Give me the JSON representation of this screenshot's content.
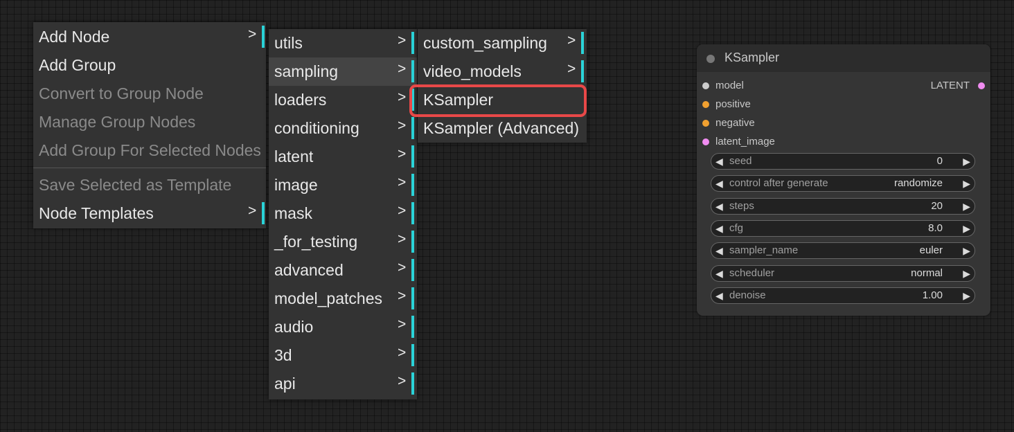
{
  "context_menu": {
    "items": [
      {
        "label": "Add Node",
        "has_submenu": true,
        "disabled": false
      },
      {
        "label": "Add Group",
        "has_submenu": false,
        "disabled": false
      },
      {
        "label": "Convert to Group Node",
        "has_submenu": false,
        "disabled": true
      },
      {
        "label": "Manage Group Nodes",
        "has_submenu": false,
        "disabled": true
      },
      {
        "label": "Add Group For Selected Nodes",
        "has_submenu": false,
        "disabled": true
      },
      {
        "label": "Save Selected as Template",
        "has_submenu": false,
        "disabled": true
      },
      {
        "label": "Node Templates",
        "has_submenu": true,
        "disabled": false
      }
    ],
    "arrow": ">"
  },
  "category_menu": {
    "items": [
      "utils",
      "sampling",
      "loaders",
      "conditioning",
      "latent",
      "image",
      "mask",
      "_for_testing",
      "advanced",
      "model_patches",
      "audio",
      "3d",
      "api"
    ],
    "highlighted": "sampling"
  },
  "sampling_menu": {
    "items": [
      {
        "label": "custom_sampling",
        "has_submenu": true
      },
      {
        "label": "video_models",
        "has_submenu": true
      },
      {
        "label": "KSampler",
        "has_submenu": false,
        "outlined": true
      },
      {
        "label": "KSampler (Advanced)",
        "has_submenu": false
      }
    ],
    "outline_color": "#e84848"
  },
  "node": {
    "title": "KSampler",
    "inputs": [
      {
        "name": "model",
        "color": "#cccccc"
      },
      {
        "name": "positive",
        "color": "#f0a030"
      },
      {
        "name": "negative",
        "color": "#f0a030"
      },
      {
        "name": "latent_image",
        "color": "#f08cf0"
      }
    ],
    "output": {
      "name": "LATENT",
      "color": "#f08cf0"
    },
    "widgets": [
      {
        "name": "seed",
        "value": "0"
      },
      {
        "name": "control after generate",
        "value": "randomize"
      },
      {
        "name": "steps",
        "value": "20"
      },
      {
        "name": "cfg",
        "value": "8.0"
      },
      {
        "name": "sampler_name",
        "value": "euler"
      },
      {
        "name": "scheduler",
        "value": "normal"
      },
      {
        "name": "denoise",
        "value": "1.00"
      }
    ],
    "left_arrow": "◀",
    "right_arrow": "▶"
  }
}
